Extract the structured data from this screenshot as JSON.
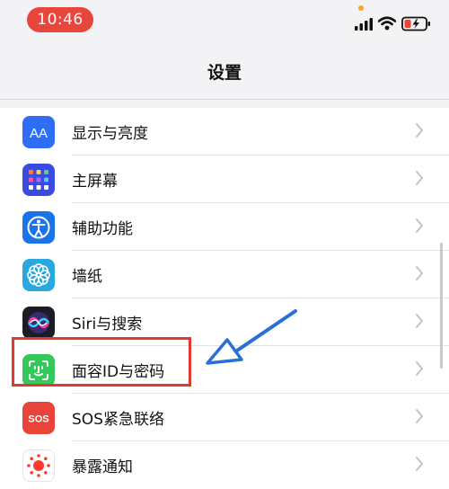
{
  "status_bar": {
    "time": "10:46"
  },
  "nav": {
    "title": "设置"
  },
  "settings": {
    "items": [
      {
        "label": "显示与亮度",
        "icon": "display-brightness-icon"
      },
      {
        "label": "主屏幕",
        "icon": "home-screen-icon"
      },
      {
        "label": "辅助功能",
        "icon": "accessibility-icon"
      },
      {
        "label": "墙纸",
        "icon": "wallpaper-icon"
      },
      {
        "label": "Siri与搜索",
        "icon": "siri-icon"
      },
      {
        "label": "面容ID与密码",
        "icon": "face-id-icon"
      },
      {
        "label": "SOS紧急联络",
        "icon": "sos-icon"
      },
      {
        "label": "暴露通知",
        "icon": "exposure-notification-icon"
      }
    ]
  },
  "icon_text": {
    "display": "AA",
    "sos": "SOS"
  },
  "colors": {
    "time_pill": "#e8453c",
    "highlight_box": "#e03a2f",
    "arrow": "#2a6fd6",
    "display_icon": "#2d6ef5",
    "home_icon": "#3b4be0",
    "accessibility_icon": "#1a73e8",
    "wallpaper_icon": "#29a8e0",
    "faceid_icon": "#34c759",
    "sos_icon": "#e9443a",
    "exposure_icon": "#ff3b30"
  }
}
